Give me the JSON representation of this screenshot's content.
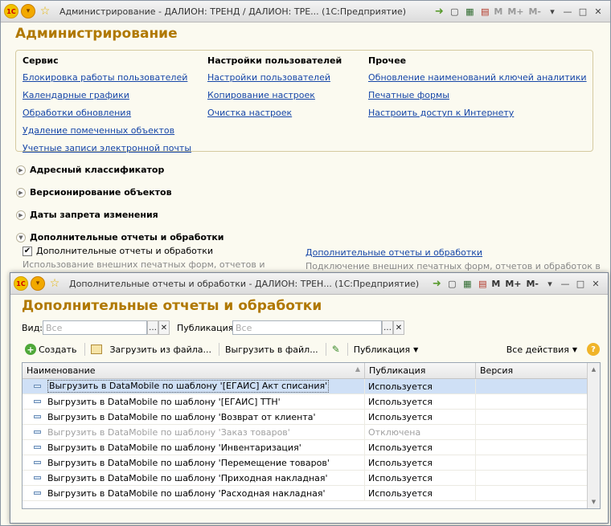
{
  "main_window": {
    "title": "Администрирование - ДАЛИОН: ТРЕНД / ДАЛИОН: ТРЕ...  (1С:Предприятие)",
    "heading": "Администрирование",
    "m_labels": [
      "M",
      "M+",
      "M-"
    ],
    "columns": [
      {
        "header": "Сервис",
        "links": [
          "Блокировка работы пользователей",
          "Календарные графики",
          "Обработки обновления",
          "Удаление помеченных объектов",
          "Учетные записи электронной почты"
        ]
      },
      {
        "header": "Настройки пользователей",
        "links": [
          "Настройки пользователей",
          "Копирование настроек",
          "Очистка настроек"
        ]
      },
      {
        "header": "Прочее",
        "links": [
          "Обновление наименований ключей аналитики",
          "Печатные формы",
          "Настроить доступ к Интернету"
        ]
      }
    ],
    "sections": [
      "Адресный классификатор",
      "Версионирование объектов",
      "Даты запрета изменения",
      "Дополнительные отчеты и обработки"
    ],
    "checkbox_label": "Дополнительные отчеты и обработки",
    "checkbox_checked": true,
    "checkbox_desc": "Использование внешних печатных форм, отчетов и",
    "right_link": "Дополнительные отчеты и обработки",
    "right_desc": "Подключение внешних печатных форм, отчетов и обработок в"
  },
  "child_window": {
    "title": "Дополнительные отчеты и обработки - ДАЛИОН: ТРЕН...  (1С:Предприятие)",
    "heading": "Дополнительные отчеты и обработки",
    "m_labels": [
      "M",
      "M+",
      "M-"
    ],
    "filter_vid_label": "Вид:",
    "filter_vid_placeholder": "Все",
    "filter_pub_label": "Публикация:",
    "filter_pub_placeholder": "Все",
    "toolbar": {
      "create": "Создать",
      "load": "Загрузить из файла...",
      "unload": "Выгрузить в файл...",
      "publication": "Публикация",
      "all_actions": "Все действия"
    },
    "columns": [
      "Наименование",
      "Публикация",
      "Версия"
    ],
    "rows": [
      {
        "name": "Выгрузить в DataMobile по шаблону '[ЕГАИС] Акт списания'",
        "publication": "Используется",
        "version": "",
        "state": "selected"
      },
      {
        "name": "Выгрузить в DataMobile по шаблону '[ЕГАИС] ТТН'",
        "publication": "Используется",
        "version": "",
        "state": "normal"
      },
      {
        "name": "Выгрузить в DataMobile по шаблону 'Возврат от клиента'",
        "publication": "Используется",
        "version": "",
        "state": "normal"
      },
      {
        "name": "Выгрузить в DataMobile по шаблону 'Заказ товаров'",
        "publication": "Отключена",
        "version": "",
        "state": "disabled"
      },
      {
        "name": "Выгрузить в DataMobile по шаблону 'Инвентаризация'",
        "publication": "Используется",
        "version": "",
        "state": "normal"
      },
      {
        "name": "Выгрузить в DataMobile по шаблону 'Перемещение товаров'",
        "publication": "Используется",
        "version": "",
        "state": "normal"
      },
      {
        "name": "Выгрузить в DataMobile по шаблону 'Приходная накладная'",
        "publication": "Используется",
        "version": "",
        "state": "normal"
      },
      {
        "name": "Выгрузить в DataMobile по шаблону 'Расходная накладная'",
        "publication": "Используется",
        "version": "",
        "state": "normal"
      }
    ]
  }
}
